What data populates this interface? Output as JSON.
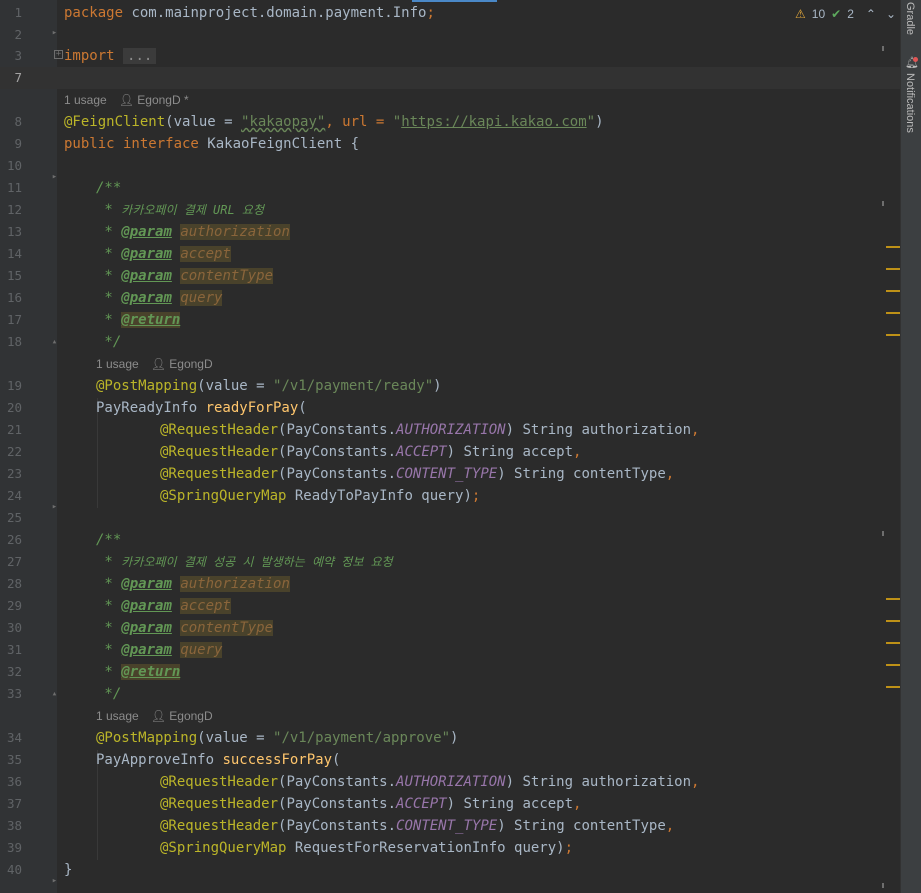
{
  "status": {
    "warnings": "10",
    "checks": "2"
  },
  "sidebar": {
    "gradle": "Gradle",
    "notifications": "Notifications"
  },
  "inlay": {
    "usage": "1 usage",
    "author_modified": "EgongD *",
    "author": "EgongD"
  },
  "code": {
    "line_numbers": [
      "1",
      "2",
      "3",
      "7",
      "8",
      "9",
      "10",
      "11",
      "12",
      "13",
      "14",
      "15",
      "16",
      "17",
      "18",
      "19",
      "20",
      "21",
      "22",
      "23",
      "24",
      "25",
      "26",
      "27",
      "28",
      "29",
      "30",
      "31",
      "32",
      "33",
      "34",
      "35",
      "36",
      "37",
      "38",
      "39",
      "40"
    ],
    "package_kw": "package",
    "package_name": " com.mainproject.domain.payment.Info",
    "semicolon": ";",
    "import_kw": "import",
    "import_fold": "...",
    "feign_ann": "@FeignClient",
    "feign_value_open": "(value = ",
    "feign_value": "\"kakaopay\"",
    "feign_url_lbl": ", url = ",
    "feign_url_q1": "\"",
    "feign_url": "https://kapi.kakao.com",
    "feign_url_q2": "\"",
    "close_paren": ")",
    "public_interface": "public interface ",
    "iface_name": "KakaoFeignClient {",
    "doc_open": "/**",
    "doc_star": " * ",
    "doc1_desc": "카카오페이 결제 URL 요청",
    "doc2_desc": "카카오페이 결제 성공 시 발생하는 예약 정보 요청",
    "param_tag": "@param",
    "return_tag": "@return",
    "p_authorization": "authorization",
    "p_accept": "accept",
    "p_contentType": "contentType",
    "p_query": "query",
    "doc_close": " */",
    "post_mapping": "@PostMapping",
    "value_open": "(value = ",
    "ready_path": "\"/v1/payment/ready\"",
    "approve_path": "\"/v1/payment/approve\"",
    "ready_type": "PayReadyInfo ",
    "ready_method": "readyForPay",
    "approve_type": "PayApproveInfo ",
    "approve_method": "successForPay",
    "open_paren": "(",
    "request_header": "@RequestHeader",
    "pc_open": "(PayConstants.",
    "c_authorization": "AUTHORIZATION",
    "c_accept": "ACCEPT",
    "c_content_type": "CONTENT_TYPE",
    "arg_authorization": ") String authorization",
    "arg_accept": ") String accept",
    "arg_content_type": ") String contentType",
    "comma": ",",
    "spring_query_map": "@SpringQueryMap",
    "arg_ready_query": " ReadyToPayInfo query)",
    "arg_approve_query": " RequestForReservationInfo query)",
    "close_brace": "}"
  }
}
